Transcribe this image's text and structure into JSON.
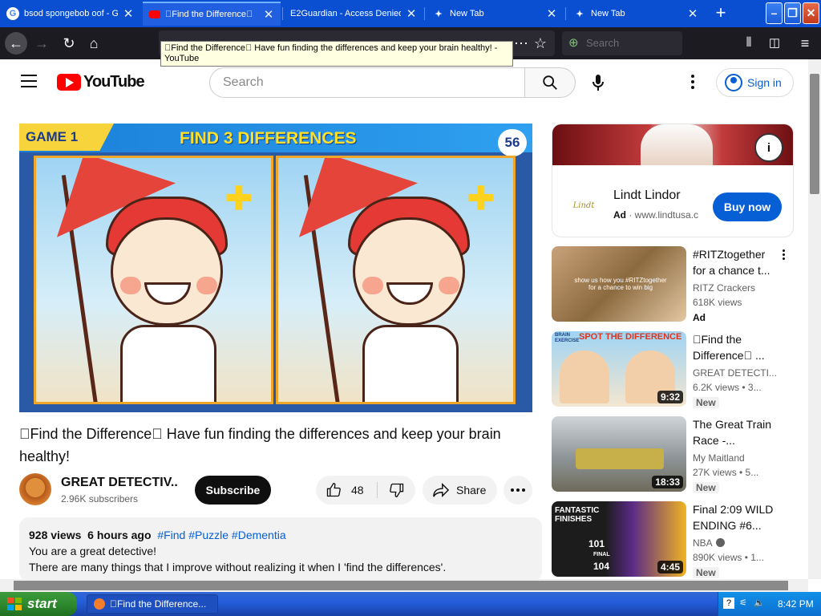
{
  "browser": {
    "tabs": [
      {
        "title": "bsod spongebob oof - G",
        "favicon": "google-icon"
      },
      {
        "title": "\u0000Find the Difference\u0000",
        "favicon": "youtube-icon",
        "active": true
      },
      {
        "title": "E2Guardian - Access Denied",
        "favicon": "none"
      },
      {
        "title": "New Tab",
        "favicon": "new-tab-icon"
      },
      {
        "title": "New Tab",
        "favicon": "new-tab-icon"
      }
    ],
    "search_placeholder": "Search",
    "tooltip": "\u0000Find the Difference\u0000 Have fun finding the differences and keep your brain healthy! - YouTube"
  },
  "youtube": {
    "logo_text": "YouTube",
    "search_placeholder": "Search",
    "sign_in": "Sign in"
  },
  "player": {
    "game_label": "GAME 1",
    "heading": "FIND 3 DIFFERENCES",
    "countdown": "56"
  },
  "video": {
    "title": "\u0000Find the Difference\u0000 Have fun finding the differences and keep your brain healthy!",
    "channel": "GREAT DETECTIV...",
    "subscribers": "2.96K subscribers",
    "subscribe_label": "Subscribe",
    "likes": "48",
    "share_label": "Share",
    "views": "928 views",
    "age": "6 hours ago",
    "hashtags": "#Find #Puzzle #Dementia",
    "description_lines": [
      "You are a great detective!",
      "There are many things that I improve without realizing it when I 'find the differences'."
    ]
  },
  "ad": {
    "brand": "Lindt Lindor",
    "logo_text": "Lindt",
    "ad_label": "Ad",
    "domain": "www.lindtusa.c",
    "cta": "Buy now"
  },
  "recommendations": [
    {
      "title": "#RITZtogether for a chance t...",
      "channel": "RITZ Crackers",
      "views": "618K views",
      "badge": "Ad",
      "duration": "",
      "thumb_text": "show us how you #RITZtogether for a chance to win big"
    },
    {
      "title": "\u0000Find the Difference\u0000 ...",
      "channel": "GREAT DETECTI...",
      "views": "6.2K views • 3...",
      "badge": "New",
      "duration": "9:32",
      "thumb_text": "SPOT THE DIFFERENCE",
      "thumb_sub": "BRAIN EXERCISE"
    },
    {
      "title": "The Great Train Race -...",
      "channel": "My Maitland",
      "views": "27K views • 5...",
      "badge": "New",
      "duration": "18:33"
    },
    {
      "title": "Final 2:09 WILD ENDING #6...",
      "channel": "NBA",
      "views": "890K views • 1...",
      "badge": "New",
      "duration": "4:45",
      "thumb_text": "FANTASTIC FINISHES",
      "score_top": "101",
      "score_bottom": "104",
      "score_label": "FINAL"
    }
  ],
  "taskbar": {
    "start": "start",
    "window_title": "\u0000Find the Difference...",
    "clock": "8:42 PM"
  },
  "colors": {
    "tabbar": "#0a4fd2",
    "youtube_red": "#ff0000",
    "link_blue": "#065fd4",
    "subscribe_bg": "#0f0f0f",
    "taskbar_blue": "#245edb",
    "start_green": "#2f8a2f"
  }
}
